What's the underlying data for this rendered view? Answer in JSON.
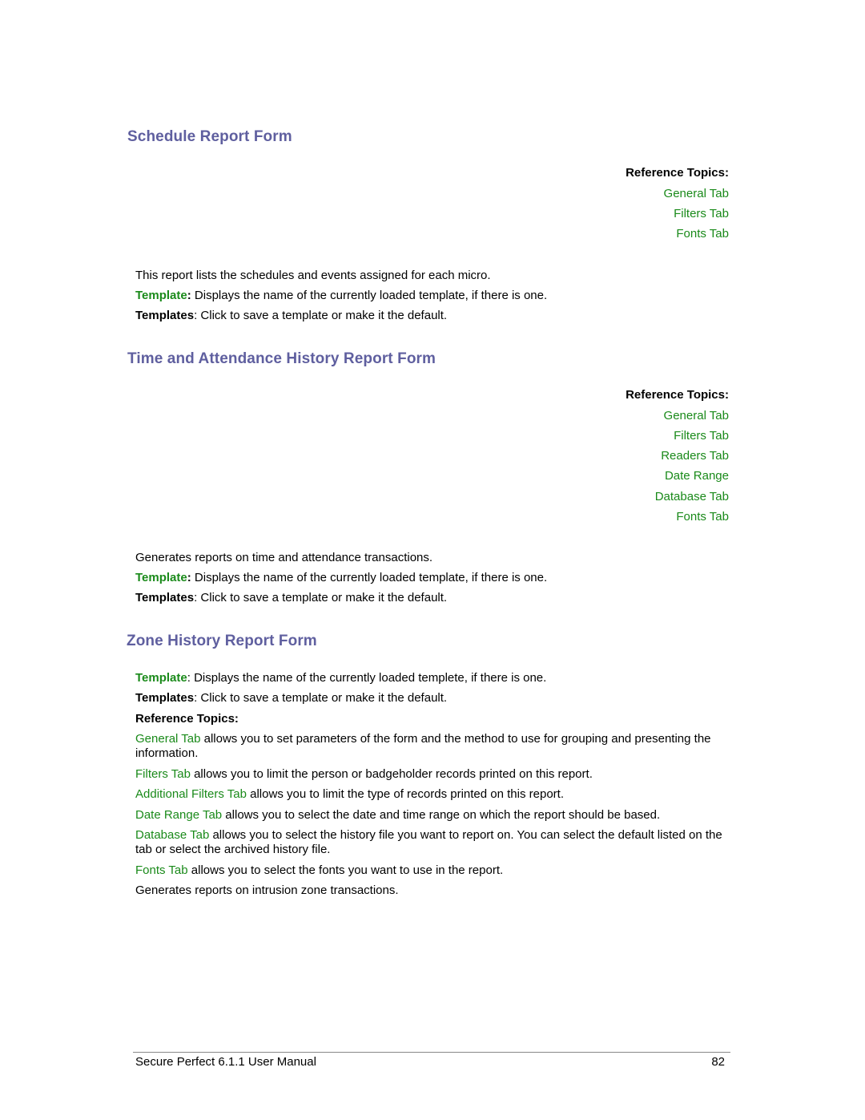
{
  "sections": [
    {
      "title": "Schedule Report Form",
      "ref_title": "Reference Topics:",
      "ref_links": [
        "General Tab",
        "Filters Tab",
        "Fonts Tab"
      ],
      "description": "This report lists the schedules and events assigned for each micro.",
      "template_label": "Template",
      "template_colon": ":",
      "template_text": " Displays the name of the currently loaded template, if there is one.",
      "templates_label": "Templates",
      "templates_text": ": Click to save a template or make it the default."
    },
    {
      "title": "Time and Attendance History Report Form",
      "ref_title": "Reference Topics:",
      "ref_links": [
        "General Tab",
        "Filters Tab",
        "Readers Tab",
        "Date Range",
        "Database Tab",
        "Fonts Tab"
      ],
      "description": "Generates reports on time and attendance transactions.",
      "template_label": "Template",
      "template_colon": ":",
      "template_text": " Displays the name of the currently loaded template, if there is one.",
      "templates_label": "Templates",
      "templates_text": ": Click to save a template or make it the default."
    },
    {
      "title": "Zone History Report Form",
      "template_label": "Template",
      "template_text": ": Displays the name of the currently loaded templete, if there is one.",
      "templates_label": "Templates",
      "templates_text": ": Click to save a template or make it the default.",
      "ref_title": "Reference Topics:",
      "ref_items": [
        {
          "link": "General Tab",
          "text": " allows you to set parameters of the form and the method to use for grouping and presenting the information."
        },
        {
          "link": "Filters Tab",
          "text": " allows you to limit the person or badgeholder records printed on this report."
        },
        {
          "link": "Additional Filters Tab",
          "text": " allows you to limit the type of records printed on this report."
        },
        {
          "link": "Date Range Tab",
          "text": " allows you to select the date and time range on which the report should be based."
        },
        {
          "link": "Database Tab",
          "text": " allows you to select the history file you want to report on. You can select the default listed on the tab or select the archived history file."
        },
        {
          "link": "Fonts Tab",
          "text": " allows you to select the fonts you want to use in the report."
        }
      ],
      "description": "Generates reports on intrusion zone transactions."
    }
  ],
  "footer": {
    "manual_title": "Secure Perfect 6.1.1 User Manual",
    "page_number": "82"
  }
}
